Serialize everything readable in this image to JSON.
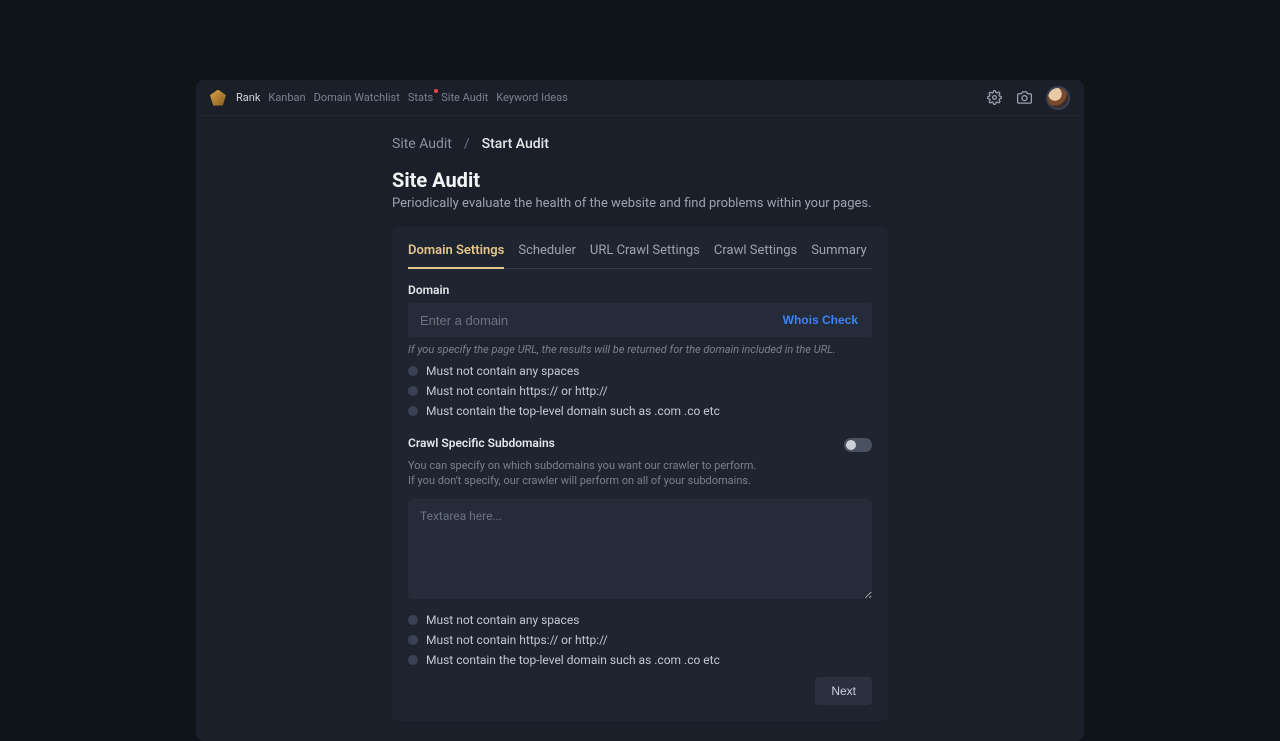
{
  "nav": {
    "items": [
      {
        "label": "Rank",
        "active": true
      },
      {
        "label": "Kanban"
      },
      {
        "label": "Domain Watchlist"
      },
      {
        "label": "Stats",
        "dot": true
      },
      {
        "label": "Site Audit"
      },
      {
        "label": "Keyword Ideas"
      }
    ]
  },
  "breadcrumb": {
    "parent": "Site Audit",
    "sep": "/",
    "current": "Start Audit"
  },
  "page": {
    "title": "Site Audit",
    "subtitle": "Periodically evaluate the health of the website and find problems within your pages."
  },
  "tabs": [
    "Domain Settings",
    "Scheduler",
    "URL Crawl Settings",
    "Crawl Settings",
    "Summary"
  ],
  "active_tab": "Domain Settings",
  "domain_section": {
    "label": "Domain",
    "placeholder": "Enter a domain",
    "whois_label": "Whois Check",
    "hint": "If you specify the page URL, the results will be returned for the domain included in the URL.",
    "rules": [
      "Must not contain any spaces",
      "Must not contain https:// or http://",
      "Must contain the top-level domain such as .com .co etc"
    ]
  },
  "subdomain_section": {
    "label": "Crawl Specific Subdomains",
    "desc_line1": "You can specify on which subdomains you want our crawler to perform.",
    "desc_line2": "If you don't specify, our crawler will perform on all of your subdomains.",
    "textarea_placeholder": "Textarea here...",
    "rules": [
      "Must not contain any spaces",
      "Must not contain https:// or http://",
      "Must contain the top-level domain such as .com .co etc"
    ],
    "toggle_on": false
  },
  "footer": {
    "next_label": "Next"
  }
}
